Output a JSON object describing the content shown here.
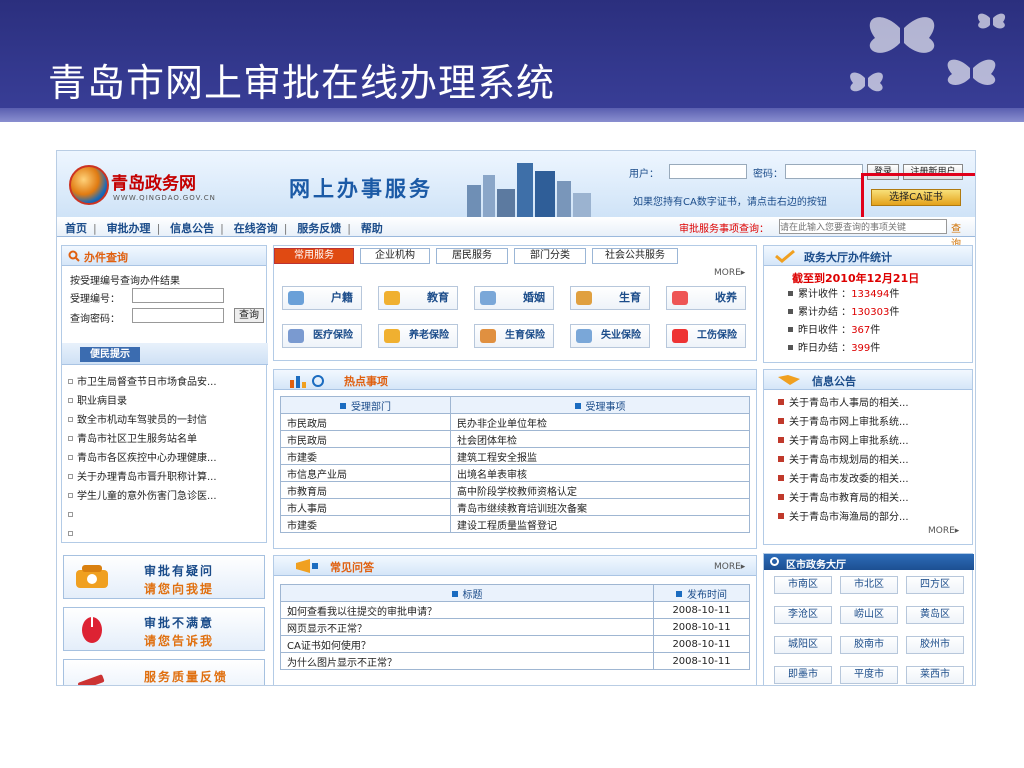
{
  "slide": {
    "title": "青岛市网上审批在线办理系统"
  },
  "header": {
    "logo_name": "青岛政务网",
    "logo_sub": "WWW.QINGDAO.GOV.CN",
    "service_title": "网上办事服务",
    "user_label": "用户：",
    "password_label": "密码：",
    "login_button": "登录",
    "register_button": "注册新用户",
    "ca_hint": "如果您持有CA数字证书，请点击右边的按钮",
    "ca_button": "选择CA证书"
  },
  "nav": {
    "items": [
      "首页",
      "审批办理",
      "信息公告",
      "在线咨询",
      "服务反馈",
      "帮助"
    ],
    "search_label": "审批服务事项查询：",
    "search_placeholder": "请在此输入您要查询的事项关键",
    "search_go": "查询"
  },
  "query_panel": {
    "title": "办件查询",
    "desc": "按受理编号查询办件结果",
    "id_label": "受理编号：",
    "code_label": "查询密码：",
    "query_button": "查询"
  },
  "tips_panel": {
    "title": "便民提示",
    "items": [
      "市卫生局督查节日市场食品安...",
      "职业病目录",
      "致全市机动车驾驶员的一封信",
      "青岛市社区卫生服务站名单",
      "青岛市各区疾控中心办理健康...",
      "关于办理青岛市晋升职称计算...",
      "学生儿童的意外伤害门急诊医..."
    ]
  },
  "help_boxes": [
    {
      "line1": "审批有疑问",
      "line2": "请您向我提"
    },
    {
      "line1": "审批不满意",
      "line2": "请您告诉我"
    },
    {
      "line1": "服务质量反馈",
      "line2": ""
    }
  ],
  "services": {
    "tabs": [
      "常用服务",
      "企业机构",
      "居民服务",
      "部门分类",
      "社会公共服务"
    ],
    "more": "MORE",
    "row1": [
      "户籍",
      "教育",
      "婚姻",
      "生育",
      "收养"
    ],
    "row2": [
      "医疗保险",
      "养老保险",
      "生育保险",
      "失业保险",
      "工伤保险"
    ]
  },
  "hot": {
    "title": "热点事项",
    "col1": "受理部门",
    "col2": "受理事项",
    "rows": [
      [
        "市民政局",
        "民办非企业单位年检"
      ],
      [
        "市民政局",
        "社会团体年检"
      ],
      [
        "市建委",
        "建筑工程安全报监"
      ],
      [
        "市信息产业局",
        "出境名单表审核"
      ],
      [
        "市教育局",
        "高中阶段学校教师资格认定"
      ],
      [
        "市人事局",
        "青岛市继续教育培训班次备案"
      ],
      [
        "市建委",
        "建设工程质量监督登记"
      ]
    ]
  },
  "faq": {
    "title": "常见问答",
    "more": "MORE",
    "col1": "标题",
    "col2": "发布时间",
    "rows": [
      [
        "如何查看我以往提交的审批申请？",
        "2008-10-11"
      ],
      [
        "网页显示不正常？",
        "2008-10-11"
      ],
      [
        "CA证书如何使用？",
        "2008-10-11"
      ],
      [
        "为什么图片显示不正常？",
        "2008-10-11"
      ]
    ]
  },
  "stats": {
    "title": "政务大厅办件统计",
    "date": "截至到2010年12月21日",
    "rows": [
      {
        "label": "累计收件",
        "value": "133494",
        "unit": "件"
      },
      {
        "label": "累计办结",
        "value": "130303",
        "unit": "件"
      },
      {
        "label": "昨日收件",
        "value": "367",
        "unit": "件"
      },
      {
        "label": "昨日办结",
        "value": "399",
        "unit": "件"
      }
    ]
  },
  "notice": {
    "title": "信息公告",
    "more": "MORE",
    "items": [
      "关于青岛市人事局的相关...",
      "关于青岛市网上审批系统...",
      "关于青岛市网上审批系统...",
      "关于青岛市规划局的相关...",
      "关于青岛市发改委的相关...",
      "关于青岛市教育局的相关...",
      "关于青岛市海渔局的部分..."
    ]
  },
  "districts": {
    "title": "区市政务大厅",
    "items": [
      "市南区",
      "市北区",
      "四方区",
      "李沧区",
      "崂山区",
      "黄岛区",
      "城阳区",
      "胶南市",
      "胶州市",
      "即墨市",
      "平度市",
      "莱西市"
    ]
  },
  "colors": {
    "header_bg": "#2b2f7e",
    "accent_orange": "#e04a12",
    "link_blue": "#1b4c8a",
    "highlight_red": "#e0001a",
    "stat_red": "#d00000"
  }
}
